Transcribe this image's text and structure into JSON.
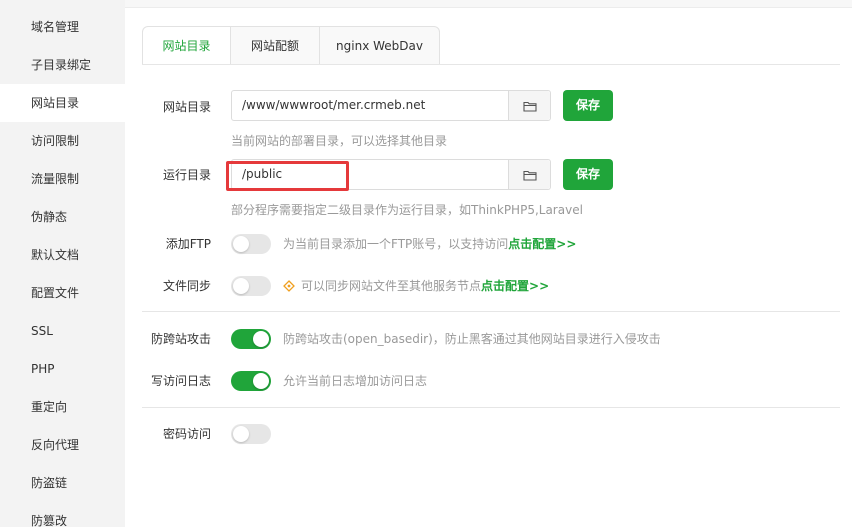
{
  "sidebar": {
    "items": [
      {
        "label": "域名管理"
      },
      {
        "label": "子目录绑定"
      },
      {
        "label": "网站目录",
        "active": true
      },
      {
        "label": "访问限制"
      },
      {
        "label": "流量限制"
      },
      {
        "label": "伪静态"
      },
      {
        "label": "默认文档"
      },
      {
        "label": "配置文件"
      },
      {
        "label": "SSL"
      },
      {
        "label": "PHP"
      },
      {
        "label": "重定向"
      },
      {
        "label": "反向代理"
      },
      {
        "label": "防盗链"
      },
      {
        "label": "防篡改"
      }
    ]
  },
  "tabs": [
    {
      "label": "网站目录",
      "active": true
    },
    {
      "label": "网站配额"
    },
    {
      "label": "nginx WebDav"
    }
  ],
  "site_dir": {
    "label": "网站目录",
    "value": "/www/wwwroot/mer.crmeb.net",
    "save_label": "保存",
    "hint": "当前网站的部署目录，可以选择其他目录"
  },
  "run_dir": {
    "label": "运行目录",
    "value": "/public",
    "save_label": "保存",
    "hint": "部分程序需要指定二级目录作为运行目录，如ThinkPHP5,Laravel"
  },
  "ftp": {
    "label": "添加FTP",
    "enabled": false,
    "hint": "为当前目录添加一个FTP账号，以支持访问",
    "link": "点击配置>>"
  },
  "sync": {
    "label": "文件同步",
    "enabled": false,
    "hint": "可以同步网站文件至其他服务节点",
    "link": "点击配置>>",
    "icon": "warning-diamond-icon"
  },
  "anti_xss": {
    "label": "防跨站攻击",
    "enabled": true,
    "hint": "防跨站攻击(open_basedir)，防止黑客通过其他网站目录进行入侵攻击"
  },
  "access_log": {
    "label": "写访问日志",
    "enabled": true,
    "hint": "允许当前日志增加访问日志"
  },
  "password_access": {
    "label": "密码访问",
    "enabled": false
  },
  "colors": {
    "accent": "#20a53a",
    "highlight": "#e5393b",
    "sidebar_bg": "#f3f3f3"
  }
}
